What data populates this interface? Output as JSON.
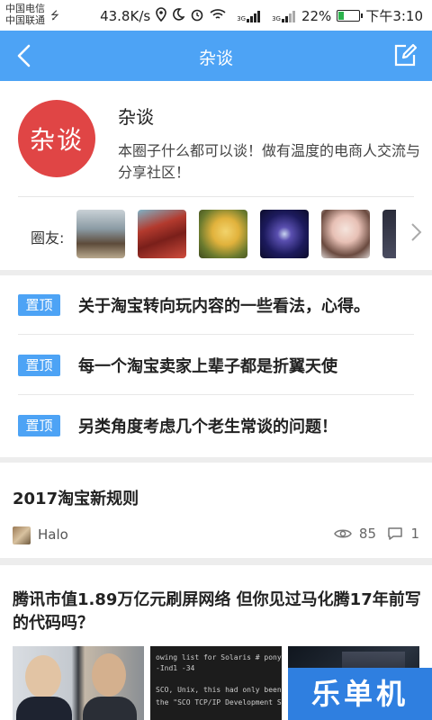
{
  "status_bar": {
    "carrier_1": "中国电信",
    "carrier_2": "中国联通",
    "net_speed": "43.8K/s",
    "signal_label_1": "3G",
    "signal_label_2": "3G",
    "battery": "22%",
    "time": "下午3:10"
  },
  "header": {
    "title": "杂谈",
    "back_icon": "back-arrow-icon",
    "edit_icon": "edit-icon"
  },
  "circle": {
    "logo_text": "杂谈",
    "name": "杂谈",
    "description": "本圈子什么都可以谈！做有温度的电商人交流与分享社区！",
    "members_label": "圈友:",
    "brand_color": "#e04545"
  },
  "pinned": {
    "badge_label": "置顶",
    "items": [
      {
        "title": "关于淘宝转向玩内容的一些看法，心得。"
      },
      {
        "title": "每一个淘宝卖家上辈子都是折翼天使"
      },
      {
        "title": "另类角度考虑几个老生常谈的问题！"
      }
    ]
  },
  "posts": [
    {
      "title": "2017淘宝新规则",
      "author": "Halo",
      "views": "85",
      "comments": "1"
    },
    {
      "title": "腾讯市值1.89万亿元刷屏网络 但你见过马化腾17年前写的代码吗？",
      "thumb_text_1": "owing list for Solaris  # pony ad",
      "thumb_text_2": "-Ind1 -34",
      "thumb_text_3": "SCO, Unix, this had only been",
      "thumb_text_4": "the \"SCO TCP/IP Development Sy"
    }
  ],
  "watermark": {
    "text": "乐单机"
  },
  "colors": {
    "accent": "#4da3f5",
    "background": "#ededed"
  }
}
